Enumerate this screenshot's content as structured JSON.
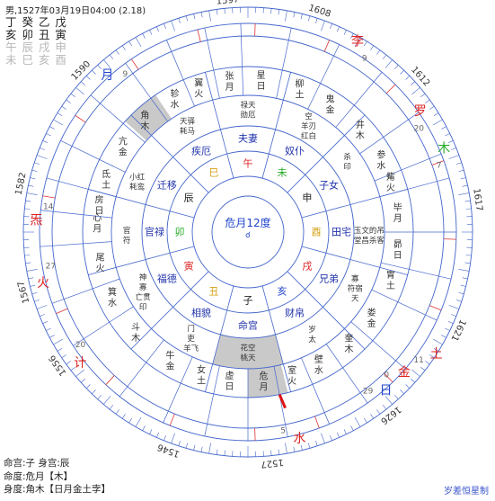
{
  "header": {
    "title": "男,1527年03月19日04:00 (2.18)"
  },
  "pillars": [
    {
      "text": "丁 癸 乙 戊",
      "color": "#222222"
    },
    {
      "text": "亥 卯 丑 寅",
      "color": "#222222"
    },
    {
      "text": "午 辰 戌 申",
      "color": "#b7b7b7"
    },
    {
      "text": "未 巳 亥 酉",
      "color": "#b7b7b7"
    }
  ],
  "years": [
    {
      "label": "1597",
      "deg": 265
    },
    {
      "label": "1608",
      "deg": 288
    },
    {
      "label": "1612",
      "deg": 318
    },
    {
      "label": "1617",
      "deg": 352
    },
    {
      "label": "1621",
      "deg": 25
    },
    {
      "label": "1626",
      "deg": 52
    },
    {
      "label": "1527",
      "deg": 84
    },
    {
      "label": "1546",
      "deg": 110
    },
    {
      "label": "1556",
      "deg": 145
    },
    {
      "label": "1567",
      "deg": 165
    },
    {
      "label": "1582",
      "deg": 192
    },
    {
      "label": "1590",
      "deg": 224
    }
  ],
  "planets": [
    {
      "label": "李",
      "num": "9",
      "color": "#dd2222",
      "deg": 300,
      "r": 222
    },
    {
      "label": "罗",
      "num": "20",
      "color": "#dd2222",
      "deg": 325,
      "r": 212
    },
    {
      "label": "木",
      "num": "7",
      "color": "#22aa22",
      "deg": 337,
      "r": 215
    },
    {
      "label": "月",
      "num": "9",
      "color": "#2244cc",
      "deg": 228,
      "r": 212
    },
    {
      "label": "炁",
      "num": "14",
      "color": "#dd2222",
      "deg": 183,
      "r": 214
    },
    {
      "label": "火",
      "num": "27",
      "color": "#dd2222",
      "deg": 166,
      "r": 213
    },
    {
      "label": "计",
      "num": "20",
      "color": "#dd2222",
      "deg": 142,
      "r": 215
    },
    {
      "label": "土",
      "num": "11",
      "color": "#dd2222",
      "deg": 33,
      "r": 228
    },
    {
      "label": "金",
      "num": "0",
      "color": "#dd2222",
      "deg": 42,
      "r": 212
    },
    {
      "label": "日",
      "num": "29",
      "color": "#2244cc",
      "deg": 49,
      "r": 212
    },
    {
      "label": "水",
      "num": "5",
      "color": "#dd2222",
      "deg": 76,
      "r": 215
    }
  ],
  "mansions": [
    {
      "text": "星日",
      "deg": 275
    },
    {
      "text": "柳土",
      "deg": 290
    },
    {
      "text": "鬼金",
      "deg": 303
    },
    {
      "text": "井木",
      "deg": 318
    },
    {
      "text": "参水",
      "deg": 332
    },
    {
      "text": "觜火",
      "deg": 341
    },
    {
      "text": "毕月",
      "deg": 353
    },
    {
      "text": "昴日",
      "deg": 7
    },
    {
      "text": "胃土",
      "deg": 19
    },
    {
      "text": "娄金",
      "deg": 35
    },
    {
      "text": "奎木",
      "deg": 48
    },
    {
      "text": "壁水",
      "deg": 62
    },
    {
      "text": "室火",
      "deg": 73
    },
    {
      "text": "危月",
      "deg": 84
    },
    {
      "text": "虚日",
      "deg": 97
    },
    {
      "text": "女土",
      "deg": 108
    },
    {
      "text": "牛金",
      "deg": 121
    },
    {
      "text": "斗木",
      "deg": 138
    },
    {
      "text": "箕水",
      "deg": 154
    },
    {
      "text": "尾火",
      "deg": 168
    },
    {
      "text": "心月",
      "deg": 183
    },
    {
      "text": "房日",
      "deg": 190
    },
    {
      "text": "氐土",
      "deg": 200
    },
    {
      "text": "亢金",
      "deg": 214
    },
    {
      "text": "角木",
      "deg": 227
    },
    {
      "text": "轸水",
      "deg": 241
    },
    {
      "text": "翼火",
      "deg": 251
    },
    {
      "text": "张月",
      "deg": 263
    }
  ],
  "palaces": [
    {
      "label": "夫妻",
      "deg": 270
    },
    {
      "label": "奴仆",
      "deg": 300
    },
    {
      "label": "子女",
      "deg": 330
    },
    {
      "label": "田宅",
      "deg": 0
    },
    {
      "label": "兄弟",
      "deg": 30
    },
    {
      "label": "财帛",
      "deg": 60
    },
    {
      "label": "命宫",
      "deg": 90
    },
    {
      "label": "相貌",
      "deg": 120
    },
    {
      "label": "福德",
      "deg": 150
    },
    {
      "label": "官禄",
      "deg": 180
    },
    {
      "label": "迁移",
      "deg": 210
    },
    {
      "label": "疾厄",
      "deg": 240
    }
  ],
  "branches": [
    {
      "label": "午",
      "color": "#dd2222",
      "deg": 270
    },
    {
      "label": "未",
      "color": "#22aa22",
      "deg": 300
    },
    {
      "label": "申",
      "color": "#222222",
      "deg": 330
    },
    {
      "label": "酉",
      "color": "#d4a017",
      "deg": 0
    },
    {
      "label": "戌",
      "color": "#dd2222",
      "deg": 30
    },
    {
      "label": "亥",
      "color": "#2244cc",
      "deg": 60
    },
    {
      "label": "子",
      "color": "#222222",
      "deg": 90
    },
    {
      "label": "丑",
      "color": "#d4a017",
      "deg": 120
    },
    {
      "label": "寅",
      "color": "#dd2222",
      "deg": 150
    },
    {
      "label": "卯",
      "color": "#22aa22",
      "deg": 180
    },
    {
      "label": "辰",
      "color": "#222222",
      "deg": 210
    },
    {
      "label": "巳",
      "color": "#d4a017",
      "deg": 240
    }
  ],
  "spirits": [
    {
      "text": "禄天 勋厄",
      "deg": 270
    },
    {
      "text": "空 羊刃 红白",
      "deg": 300
    },
    {
      "text": "杀 印",
      "deg": 325
    },
    {
      "text": "玉文的吊 堂昌杀客",
      "deg": 2
    },
    {
      "text": "寡 符宿 天",
      "deg": 28
    },
    {
      "text": "岁 太",
      "deg": 58
    },
    {
      "text": "花空 桃天",
      "deg": 90
    },
    {
      "text": "门 吏 羊飞",
      "deg": 118
    },
    {
      "text": "神 寡 亡贯 印",
      "deg": 150
    },
    {
      "text": "官 符",
      "deg": 178
    },
    {
      "text": "小红 耗鸾",
      "deg": 204
    },
    {
      "text": "天驿 耗马",
      "deg": 240
    }
  ],
  "center": {
    "text": "危月12度"
  },
  "footer": {
    "line1": "命宫:子  身宫:辰",
    "line2": "命度:危月【木】",
    "line3": "身度:角木【日月金土孛】"
  },
  "credit": "岁差恒星制"
}
